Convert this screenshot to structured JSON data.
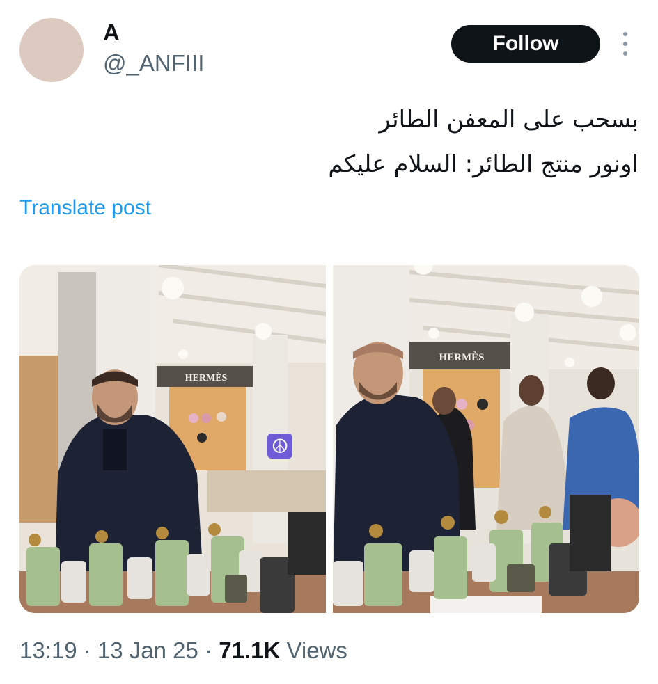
{
  "author": {
    "display_name": "A",
    "handle": "@_ANFIII"
  },
  "follow_label": "Follow",
  "tweet": {
    "lines": [
      "بسحب على المعفن الطائر",
      "اونور منتج الطائر: السلام عليكم"
    ],
    "translate_label": "Translate post"
  },
  "media": {
    "store_sign": "HERMÈS",
    "peace_emoji": "☮"
  },
  "meta": {
    "time": "13:19",
    "sep1": " · ",
    "date": "13 Jan 25",
    "sep2": " · ",
    "views_count": "71.1K",
    "views_label": " Views"
  }
}
